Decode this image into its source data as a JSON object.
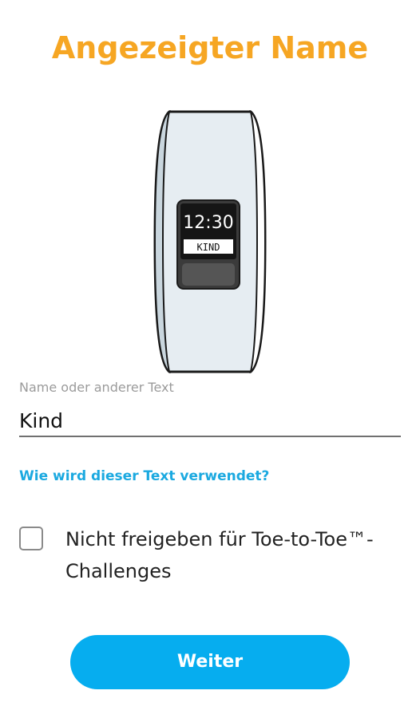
{
  "header": {
    "title": "Angezeigter Name"
  },
  "device_preview": {
    "time": "12:30",
    "name_label": "KIND"
  },
  "name_field": {
    "label": "Name oder anderer Text",
    "value": "Kind"
  },
  "help_link": {
    "label": "Wie wird dieser Text verwendet?"
  },
  "share_option": {
    "label": "Nicht freigeben für Toe-to-Toe™-Challenges",
    "checked": false
  },
  "actions": {
    "continue_label": "Weiter"
  },
  "colors": {
    "title": "#F6A623",
    "accent": "#06ADEF",
    "link": "#1BA9E0"
  }
}
